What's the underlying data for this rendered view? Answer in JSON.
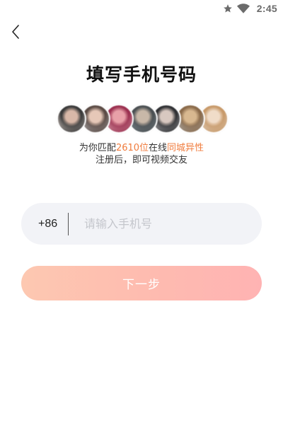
{
  "status_bar": {
    "time": "2:45",
    "icons": [
      "star-icon",
      "wifi-icon"
    ]
  },
  "header": {
    "back_icon": "chevron-left-icon",
    "title": "填写手机号码"
  },
  "avatars": [
    {
      "name": "avatar-1",
      "colors": [
        "#3a3a3a",
        "#d9b8a8",
        "#f4e6df"
      ]
    },
    {
      "name": "avatar-2",
      "colors": [
        "#5a4a44",
        "#e6c8b8",
        "#cfd6dc"
      ]
    },
    {
      "name": "avatar-3",
      "colors": [
        "#9b3050",
        "#e8a0a8",
        "#f5d8d8"
      ]
    },
    {
      "name": "avatar-4",
      "colors": [
        "#4a4f52",
        "#c8b8a8",
        "#8fa0a8"
      ]
    },
    {
      "name": "avatar-5",
      "colors": [
        "#2f3033",
        "#d8c8c0",
        "#e8e8ea"
      ]
    },
    {
      "name": "avatar-6",
      "colors": [
        "#8a6a4a",
        "#d8b890",
        "#b8c8d8"
      ]
    },
    {
      "name": "avatar-7",
      "colors": [
        "#c89a6a",
        "#f0dcc8",
        "#e8e0d8"
      ]
    }
  ],
  "match": {
    "prefix": "为你匹配",
    "count": "2610位",
    "middle": "在线",
    "highlight": "同城异性",
    "subtext": "注册后，即可视频交友"
  },
  "phone": {
    "country_code": "+86",
    "value": "",
    "placeholder": "请输入手机号"
  },
  "next_button": {
    "label": "下一步"
  },
  "colors": {
    "highlight": "#f07b3c",
    "button_gradient_start": "#fdc8b1",
    "button_gradient_end": "#ffb3b3",
    "input_bg": "#f2f3f7"
  }
}
